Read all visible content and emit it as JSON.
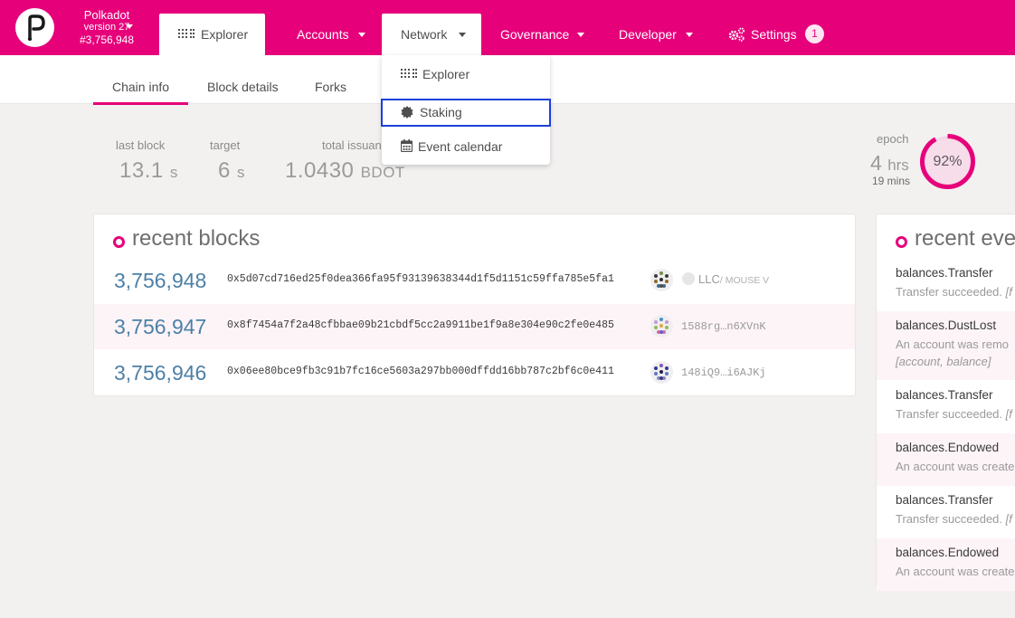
{
  "chain": {
    "name": "Polkadot",
    "version": "version 27",
    "block": "#3,756,948"
  },
  "topnav": {
    "explorer": "Explorer",
    "accounts": "Accounts",
    "network": "Network",
    "governance": "Governance",
    "developer": "Developer",
    "settings": "Settings",
    "settings_badge": "1"
  },
  "dropdown": {
    "explorer": "Explorer",
    "staking": "Staking",
    "event_calendar": "Event calendar"
  },
  "subnav": {
    "chain_info": "Chain info",
    "block_details": "Block details",
    "forks": "Forks"
  },
  "summary": {
    "last_block_label": "last block",
    "last_block_value": "13.1",
    "last_block_unit": "s",
    "target_label": "target",
    "target_value": "6",
    "target_unit": "s",
    "total_issuance_label": "total issuan",
    "total_issuance_value": "1.0430",
    "total_issuance_unit": "BDOT"
  },
  "epoch": {
    "label": "epoch",
    "hours": "4",
    "hours_unit": "hrs",
    "minutes": "19 mins",
    "percent_label": "92%",
    "progress": 0.92
  },
  "recent_blocks": {
    "title": "recent blocks",
    "rows": [
      {
        "number": "3,756,948",
        "hash": "0x5d07cd716ed25f0dea366fa95f93139638344d1f5d1151c59ffa785e5fa1",
        "author": "LLC",
        "author_sub": "/ MOUSE V"
      },
      {
        "number": "3,756,947",
        "hash": "0x8f7454a7f2a48cfbbae09b21cbdf5cc2a9911be1f9a8e304e90c2fe0e485",
        "author": "1588rg…n6XVnK"
      },
      {
        "number": "3,756,946",
        "hash": "0x06ee80bce9fb3c91b7fc16ce5603a297bb000dffdd16bb787c2bf6c0e411",
        "author": "148iQ9…i6AJKj"
      }
    ]
  },
  "recent_events": {
    "title": "recent ever",
    "rows": [
      {
        "name": "balances.Transfer",
        "desc": "Transfer succeeded.",
        "extra": "[f"
      },
      {
        "name": "balances.DustLost",
        "desc": "An account was remo",
        "extra": "[account, balance]"
      },
      {
        "name": "balances.Transfer",
        "desc": "Transfer succeeded.",
        "extra": "[f"
      },
      {
        "name": "balances.Endowed",
        "desc": "An account was create"
      },
      {
        "name": "balances.Transfer",
        "desc": "Transfer succeeded.",
        "extra": "[f"
      },
      {
        "name": "balances.Endowed",
        "desc": "An account was create"
      }
    ]
  },
  "colors": {
    "brand": "#e6007a",
    "link": "#4d80a6",
    "highlight": "#1b3fdb"
  }
}
